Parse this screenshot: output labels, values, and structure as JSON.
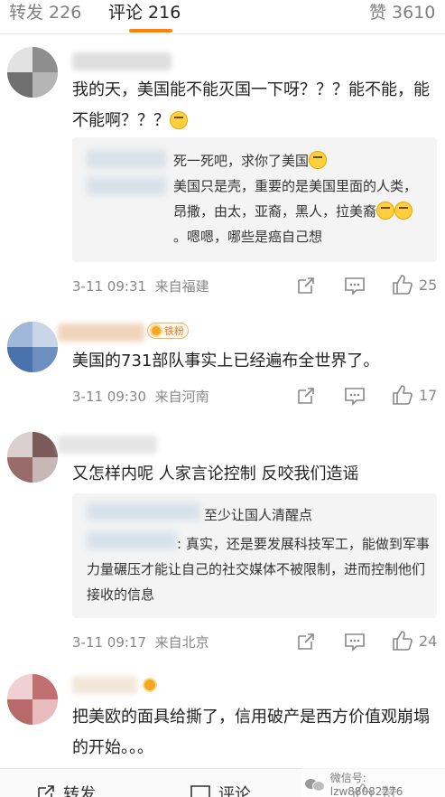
{
  "tabs": {
    "repost": "转发 226",
    "comments": "评论 216",
    "likes": "赞 3610"
  },
  "comments": [
    {
      "text": "我的天，美国能不能灭国一下呀？？？能不能，能不能啊？？？",
      "replies": [
        "死一死吧，求你了美国",
        "美国只是壳，重要的是美国里面的人类，昂撒，由太，亚裔，黑人，拉美裔",
        "。嗯嗯，哪些是癌自己想"
      ],
      "time": "3-11 09:31",
      "location": "来自福建",
      "likes": "25"
    },
    {
      "badge": "铁粉",
      "text": "美国的731部队事实上已经遍布全世界了。",
      "time": "3-11 09:30",
      "location": "来自河南",
      "likes": "17"
    },
    {
      "text": "又怎样内呢 人家言论控制 反咬我们造谣",
      "replies": [
        "至少让国人清醒点",
        ": 真实，还是要发展科技军工，能做到军事力量碾压才能让自己的社交媒体不被限制，进而控制他们接收的信息"
      ],
      "time": "3-11 09:17",
      "location": "来自北京",
      "likes": "24"
    },
    {
      "text": "把美欧的面具给撕了，信用破产是西方价值观崩塌的开始。。。"
    }
  ],
  "bottom": {
    "repost": "转发",
    "comment": "评论",
    "like": "赞"
  },
  "watermark": "微信号: lzw88082276",
  "colors": {
    "accent": "#ff8200",
    "badge": "#e67e22"
  }
}
